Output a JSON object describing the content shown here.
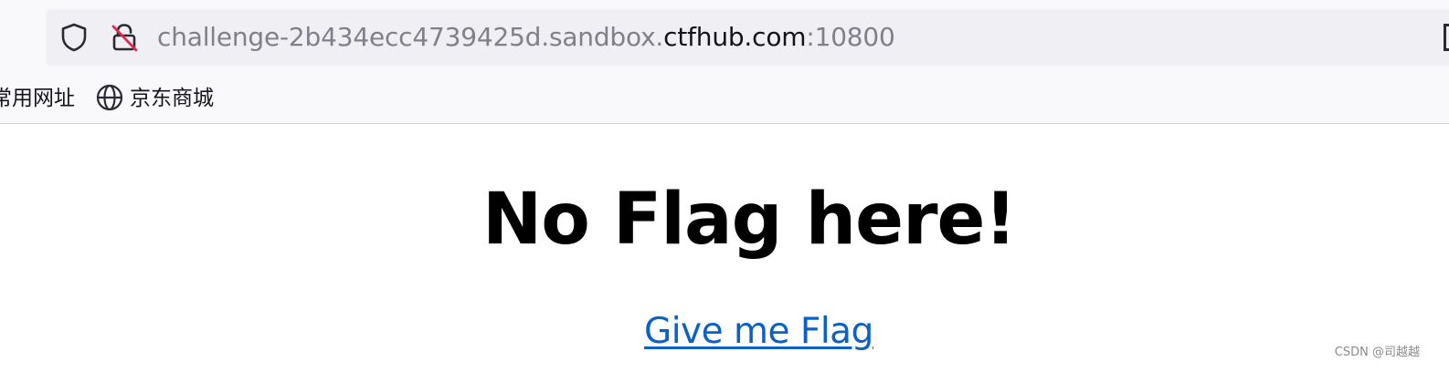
{
  "address_bar": {
    "url_prefix": "challenge-2b434ecc4739425d.sandbox.",
    "url_host": "ctfhub.com",
    "url_port": ":10800"
  },
  "bookmarks": [
    {
      "label": "常用网址"
    },
    {
      "label": "京东商城",
      "icon": "globe-icon"
    }
  ],
  "page": {
    "title": "No Flag here!",
    "link_label": "Give me Flag"
  },
  "watermark": "CSDN @司越越",
  "colors": {
    "link": "#0b61c4",
    "url_dim": "#80808a",
    "url_host": "#15141a",
    "lock_strike": "#e22850"
  }
}
